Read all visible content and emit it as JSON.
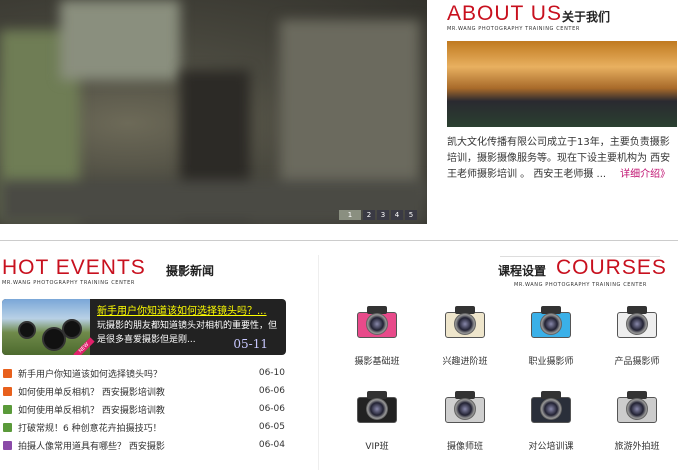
{
  "slider": {
    "pages": [
      "1",
      "2",
      "3",
      "4",
      "5"
    ],
    "active": 0
  },
  "about": {
    "title_en": "ABOUT US",
    "title_cn": "关于我们",
    "subtitle": "MR.WANG PHOTOGRAPHY TRAINING CENTER",
    "text": "凯大文化传播有限公司成立于13年，主要负责摄影培训，摄影摄像服务等。现在下设主要机构为 西安王老师摄影培训 。 西安王老师摄 ...",
    "more": "详细介绍》"
  },
  "hot": {
    "title_en": "HOT EVENTS",
    "title_cn": "摄影新闻",
    "subtitle": "MR.WANG PHOTOGRAPHY TRAINING CENTER",
    "featured": {
      "title": "新手用户你知道该如何选择镜头吗？...",
      "desc": "玩摄影的朋友都知道镜头对相机的重要性，但是很多喜爱摄影但是刚...",
      "date": "05-11",
      "badge": "NEW"
    },
    "items": [
      {
        "title": "新手用户你知道该如何选择镜头吗？",
        "date": "06-10",
        "color": "#e8601c"
      },
      {
        "title": "如何使用单反相机？ 西安摄影培训教",
        "date": "06-06",
        "color": "#e8601c"
      },
      {
        "title": "如何使用单反相机？ 西安摄影培训教",
        "date": "06-06",
        "color": "#5a9a3a"
      },
      {
        "title": "打破常规！6 种创意花卉拍摄技巧！",
        "date": "06-05",
        "color": "#5a9a3a"
      },
      {
        "title": "拍摄人像常用道具有哪些？ 西安摄影",
        "date": "06-04",
        "color": "#8a4aa8"
      }
    ]
  },
  "courses": {
    "title_cn": "课程设置",
    "title_en": "COURSES",
    "subtitle": "MR.WANG PHOTOGRAPHY TRAINING CENTER",
    "items": [
      {
        "label": "摄影基础班",
        "color": "#e84a8a"
      },
      {
        "label": "兴趣进阶班",
        "color": "#efe6cc"
      },
      {
        "label": "职业摄影师",
        "color": "#3ab0e8"
      },
      {
        "label": "产品摄影师",
        "color": "#eeeeee"
      },
      {
        "label": "VIP班",
        "color": "#222222"
      },
      {
        "label": "摄像师班",
        "color": "#cfcfcf"
      },
      {
        "label": "对公培训课",
        "color": "#2a2f3a"
      },
      {
        "label": "旅游外拍班",
        "color": "#cccccc"
      }
    ]
  }
}
